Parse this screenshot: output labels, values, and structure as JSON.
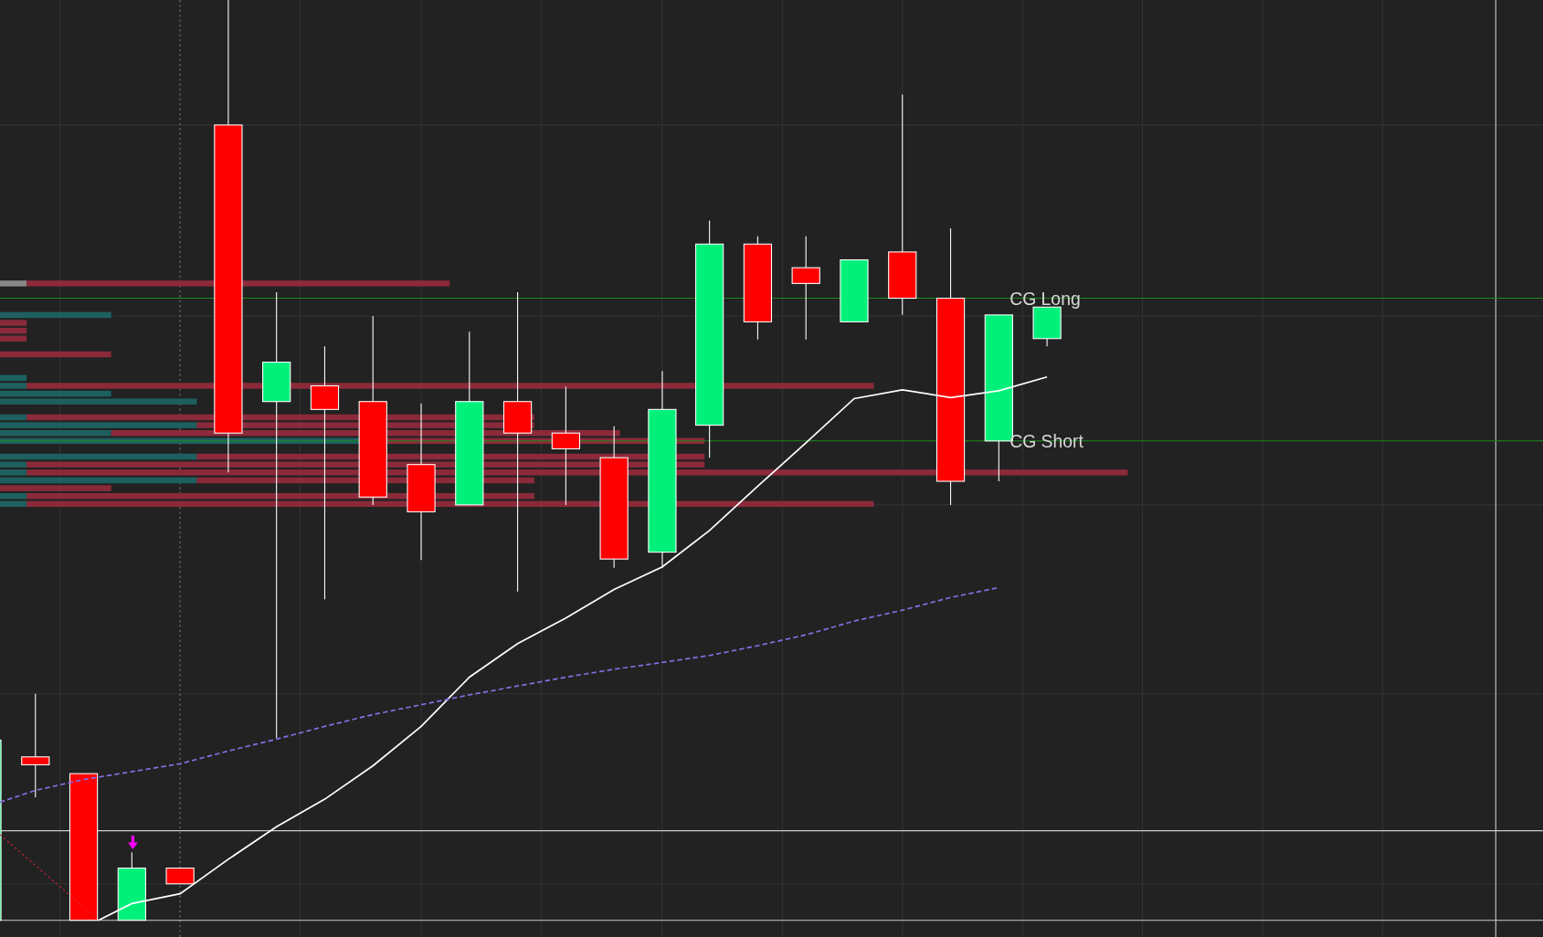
{
  "chart": {
    "levels": [
      {
        "label": "CG Long",
        "kind": "long"
      },
      {
        "label": "CG Short",
        "kind": "short"
      }
    ]
  }
}
